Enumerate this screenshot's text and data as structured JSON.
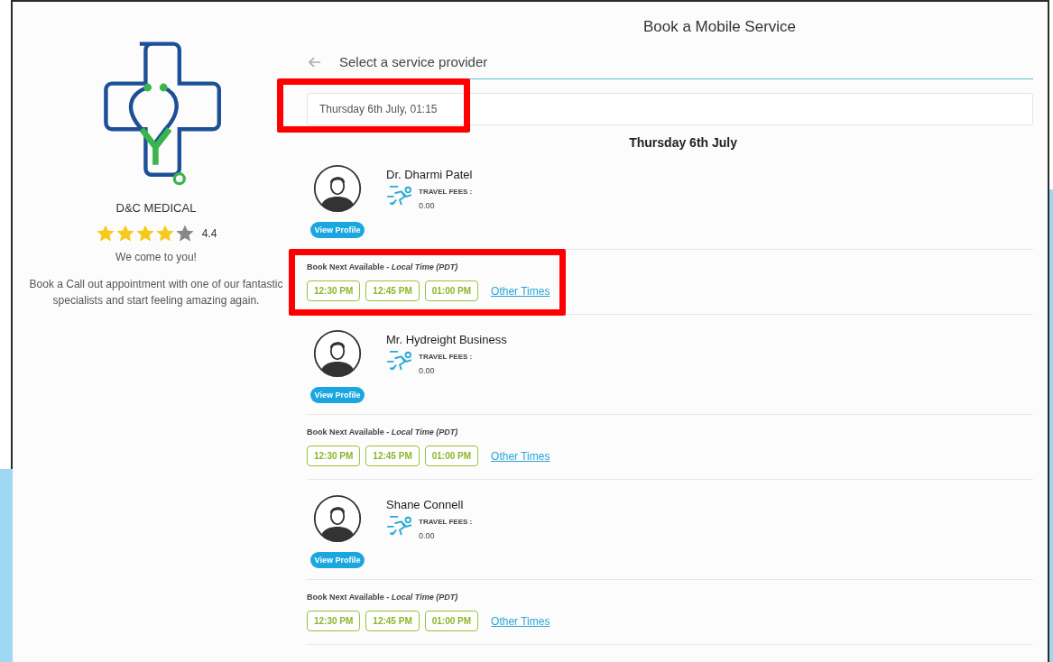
{
  "page_title": "Book a Mobile Service",
  "clinic": {
    "name": "D&C MEDICAL",
    "stars": 4,
    "rating": "4.4",
    "tagline": "We come to you!",
    "description": "Book a Call out appointment with one of our fantastic specialists and start feeling amazing again."
  },
  "step": {
    "title": "Select a service provider"
  },
  "date_field": {
    "value": "Thursday 6th July, 01:15",
    "highlighted": true
  },
  "day_heading": "Thursday 6th July",
  "providers": [
    {
      "name": "Dr. Dharmi Patel",
      "fees_label": "TRAVEL FEES :",
      "fees": "0.00",
      "profile_button": "View Profile",
      "availability": "Book Next Available - *Local Time (PDT)*",
      "slots": [
        "12:30 PM",
        "12:45 PM",
        "01:00 PM"
      ],
      "other_times": "Other Times",
      "highlighted": true
    },
    {
      "name": "Mr. Hydreight Business",
      "fees_label": "TRAVEL FEES :",
      "fees": "0.00",
      "profile_button": "View Profile",
      "availability": "Book Next Available - *Local Time (PDT)*",
      "slots": [
        "12:30 PM",
        "12:45 PM",
        "01:00 PM"
      ],
      "other_times": "Other Times",
      "highlighted": false
    },
    {
      "name": "Shane Connell",
      "fees_label": "TRAVEL FEES :",
      "fees": "0.00",
      "profile_button": "View Profile",
      "availability": "Book Next Available - *Local Time (PDT)*",
      "slots": [
        "12:30 PM",
        "12:45 PM",
        "01:00 PM"
      ],
      "other_times": "Other Times",
      "highlighted": false
    }
  ]
}
